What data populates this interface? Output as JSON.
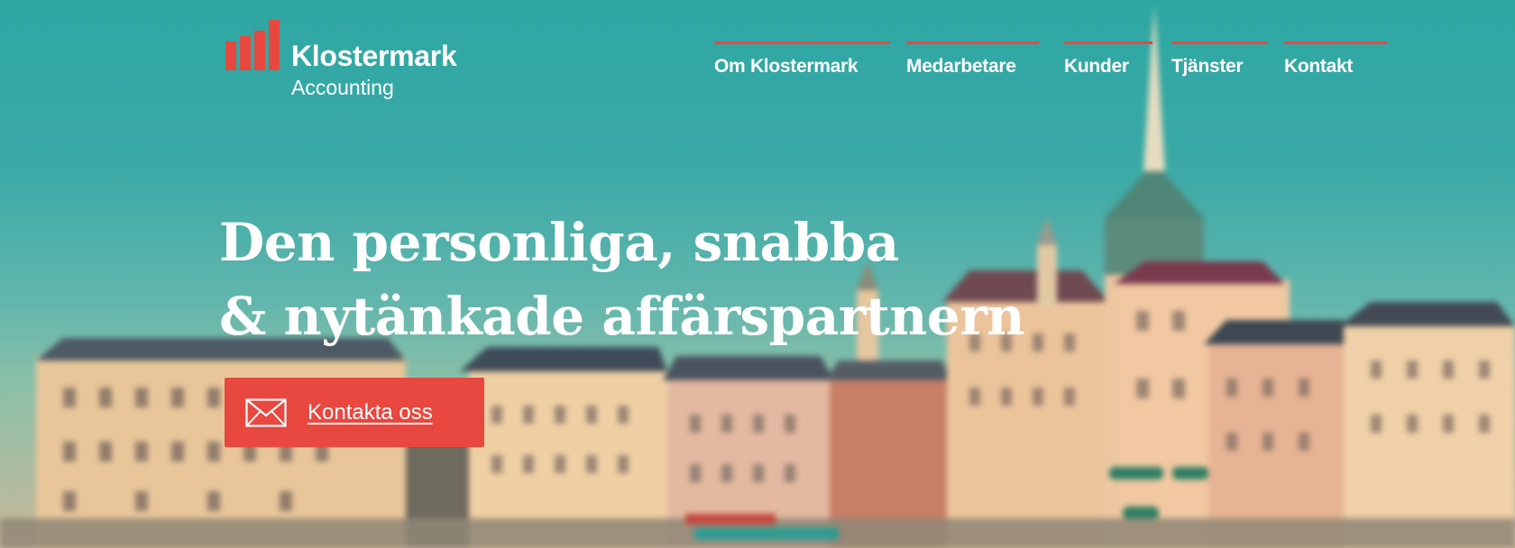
{
  "brand": {
    "name": "Klostermark",
    "subtitle": "Accounting",
    "logo_icon": "bar-chart-logo-icon",
    "accent_color": "#e8483f"
  },
  "nav": {
    "items": [
      {
        "label": "Om Klostermark"
      },
      {
        "label": "Medarbetare"
      },
      {
        "label": "Kunder"
      },
      {
        "label": "Tjänster"
      },
      {
        "label": "Kontakt"
      }
    ]
  },
  "hero": {
    "headline_line1": "Den personliga, snabba",
    "headline_line2": "& nytänkade affärspartnern",
    "cta_label": "Kontakta oss",
    "cta_icon": "envelope-icon"
  }
}
